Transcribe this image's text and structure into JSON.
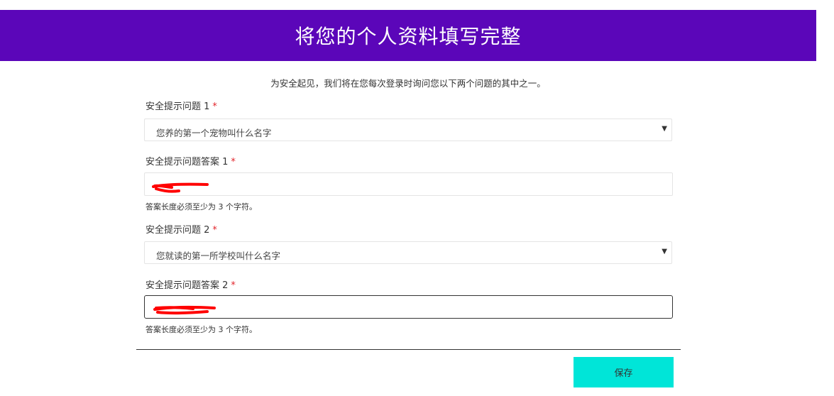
{
  "header": {
    "title": "将您的个人资料填写完整"
  },
  "intro": "为安全起见，我们将在您每次登录时询问您以下两个问题的其中之一。",
  "q1": {
    "label": "安全提示问题 1",
    "required_mark": "*",
    "selected": "您养的第一个宠物叫什么名字"
  },
  "a1": {
    "label": "安全提示问题答案 1",
    "required_mark": "*",
    "help": "答案长度必须至少为 3 个字符。"
  },
  "q2": {
    "label": "安全提示问题 2",
    "required_mark": "*",
    "selected": "您就读的第一所学校叫什么名字"
  },
  "a2": {
    "label": "安全提示问题答案 2",
    "required_mark": "*",
    "help": "答案长度必须至少为 3 个字符。"
  },
  "actions": {
    "save_label": "保存"
  },
  "colors": {
    "header_bg": "#5b06b9",
    "button_bg": "#00e5d8",
    "required": "#e2252c",
    "redaction": "#ff0000"
  },
  "icons": {
    "select_arrow": "caret-down-icon"
  }
}
